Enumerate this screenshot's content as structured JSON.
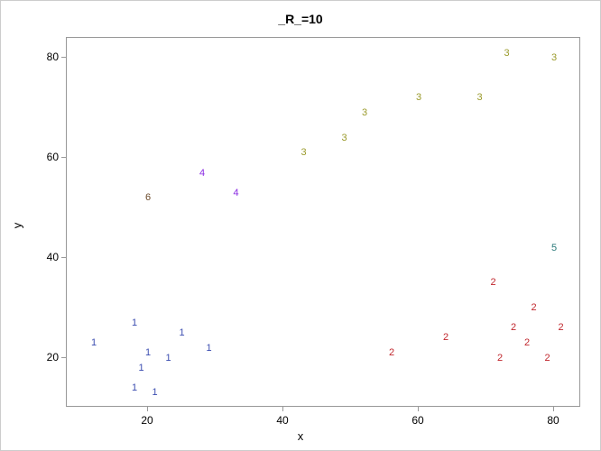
{
  "chart_data": {
    "type": "scatter",
    "title": "_R_=10",
    "xlabel": "x",
    "ylabel": "y",
    "xlim": [
      8,
      84
    ],
    "ylim": [
      10,
      84
    ],
    "xticks": [
      20,
      40,
      60,
      80
    ],
    "yticks": [
      20,
      40,
      60,
      80
    ],
    "series": [
      {
        "name": "1",
        "color": "#3b4db0",
        "points": [
          {
            "x": 12,
            "y": 23
          },
          {
            "x": 18,
            "y": 27
          },
          {
            "x": 18,
            "y": 14
          },
          {
            "x": 19,
            "y": 18
          },
          {
            "x": 20,
            "y": 21
          },
          {
            "x": 21,
            "y": 13
          },
          {
            "x": 23,
            "y": 20
          },
          {
            "x": 25,
            "y": 25
          },
          {
            "x": 29,
            "y": 22
          }
        ]
      },
      {
        "name": "2",
        "color": "#c1272d",
        "points": [
          {
            "x": 56,
            "y": 21
          },
          {
            "x": 64,
            "y": 24
          },
          {
            "x": 71,
            "y": 35
          },
          {
            "x": 72,
            "y": 20
          },
          {
            "x": 74,
            "y": 26
          },
          {
            "x": 76,
            "y": 23
          },
          {
            "x": 77,
            "y": 30
          },
          {
            "x": 79,
            "y": 20
          },
          {
            "x": 81,
            "y": 26
          }
        ]
      },
      {
        "name": "3",
        "color": "#9a9a2a",
        "points": [
          {
            "x": 43,
            "y": 61
          },
          {
            "x": 49,
            "y": 64
          },
          {
            "x": 52,
            "y": 69
          },
          {
            "x": 60,
            "y": 72
          },
          {
            "x": 69,
            "y": 72
          },
          {
            "x": 73,
            "y": 81
          },
          {
            "x": 80,
            "y": 80
          }
        ]
      },
      {
        "name": "4",
        "color": "#8a2be2",
        "points": [
          {
            "x": 28,
            "y": 57
          },
          {
            "x": 33,
            "y": 53
          }
        ]
      },
      {
        "name": "5",
        "color": "#2a7a7a",
        "points": [
          {
            "x": 80,
            "y": 42
          }
        ]
      },
      {
        "name": "6",
        "color": "#6b4a2a",
        "points": [
          {
            "x": 20,
            "y": 52
          }
        ]
      }
    ]
  }
}
